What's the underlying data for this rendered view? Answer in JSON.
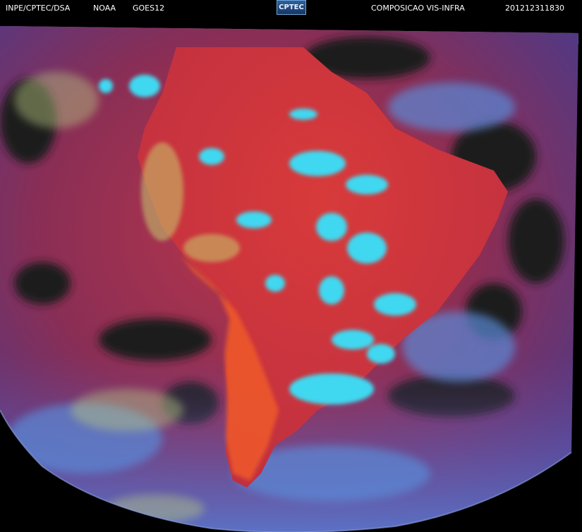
{
  "header": {
    "agency": "INPE/CPTEC/DSA",
    "source": "NOAA",
    "satellite": "GOES12",
    "logo_text": "CPTEC",
    "product": "COMPOSICAO VIS-INFRA",
    "timestamp": "201212311830"
  },
  "colors": {
    "space": "#000000",
    "no_data": "#9a9a9a",
    "land": "#d2363a",
    "ocean": "#7a2a4a",
    "cloud_high": "#3fd8f0",
    "cloud_low": "#6a6ab8",
    "clear_ocean": "#1a1a1a"
  }
}
